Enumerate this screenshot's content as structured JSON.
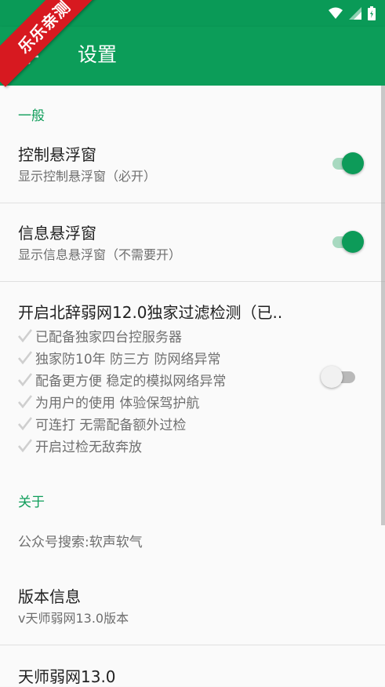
{
  "ribbon": {
    "label": "乐乐亲测"
  },
  "toolbar": {
    "title": "设置"
  },
  "sections": {
    "general": "一般",
    "about": "关于"
  },
  "prefs": {
    "control_float": {
      "title": "控制悬浮窗",
      "summary": "显示控制悬浮窗（必开）",
      "enabled": true
    },
    "info_float": {
      "title": "信息悬浮窗",
      "summary": "显示信息悬浮窗（不需要开）",
      "enabled": true
    },
    "filter": {
      "title": "开启北辞弱网12.0独家过滤检测（已..",
      "enabled": false,
      "features": [
        "已配备独家四台控服务器",
        "独家防10年 防三方 防网络异常",
        "配备更方便 稳定的模拟网络异常",
        "为用户的使用 体验保驾护航",
        "可连打 无需配备额外过检",
        "开启过检无敌奔放"
      ]
    },
    "wechat": {
      "title": "公众号搜索:软声软气"
    },
    "version": {
      "title": "版本信息",
      "summary": "v天师弱网13.0版本"
    },
    "app": {
      "title": "天师弱网13.0"
    }
  },
  "colors": {
    "primary": "#0c9d59",
    "accent": "#0f9d5a",
    "ribbon": "#d71920"
  }
}
